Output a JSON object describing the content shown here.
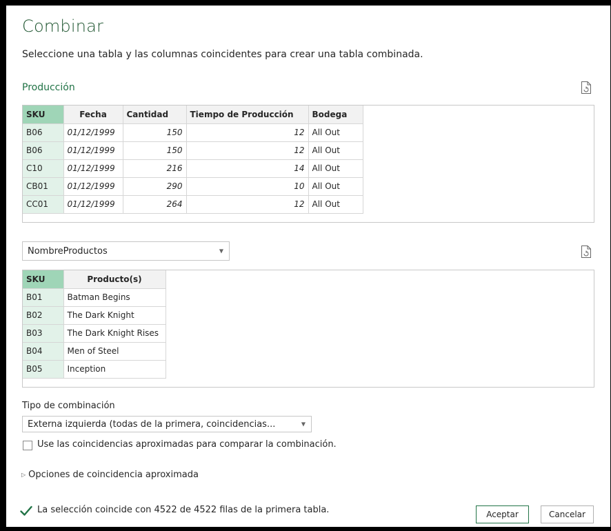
{
  "dialog": {
    "title": "Combinar",
    "subtitle": "Seleccione una tabla y las columnas coincidentes para crear una tabla combinada."
  },
  "first_table": {
    "name": "Producción",
    "columns": [
      "SKU",
      "Fecha",
      "Cantidad",
      "Tiempo de Producción",
      "Bodega"
    ],
    "rows": [
      [
        "B06",
        "01/12/1999",
        "150",
        "12",
        "All Out"
      ],
      [
        "B06",
        "01/12/1999",
        "150",
        "12",
        "All Out"
      ],
      [
        "C10",
        "01/12/1999",
        "216",
        "14",
        "All Out"
      ],
      [
        "CB01",
        "01/12/1999",
        "290",
        "10",
        "All Out"
      ],
      [
        "CC01",
        "01/12/1999",
        "264",
        "12",
        "All Out"
      ]
    ]
  },
  "second_table": {
    "selected": "NombreProductos",
    "columns": [
      "SKU",
      "Producto(s)"
    ],
    "rows": [
      [
        "B01",
        "Batman Begins"
      ],
      [
        "B02",
        "The Dark Knight"
      ],
      [
        "B03",
        "The Dark Knight Rises"
      ],
      [
        "B04",
        "Men of Steel"
      ],
      [
        "B05",
        "Inception"
      ]
    ]
  },
  "join": {
    "label": "Tipo de combinación",
    "selected": "Externa izquierda (todas de la primera, coincidencias..."
  },
  "fuzzy": {
    "checkbox_label": "Use las coincidencias aproximadas para comparar la combinación.",
    "checked": false,
    "options_label": "Opciones de coincidencia aproximada"
  },
  "status": {
    "text": "La selección coincide con 4522 de 4522 filas de la primera tabla."
  },
  "buttons": {
    "ok": "Aceptar",
    "cancel": "Cancelar"
  },
  "colors": {
    "accent": "#217346",
    "title": "#215732",
    "selected_header": "#9fd5b7",
    "selected_cell": "#e2f2e9"
  }
}
